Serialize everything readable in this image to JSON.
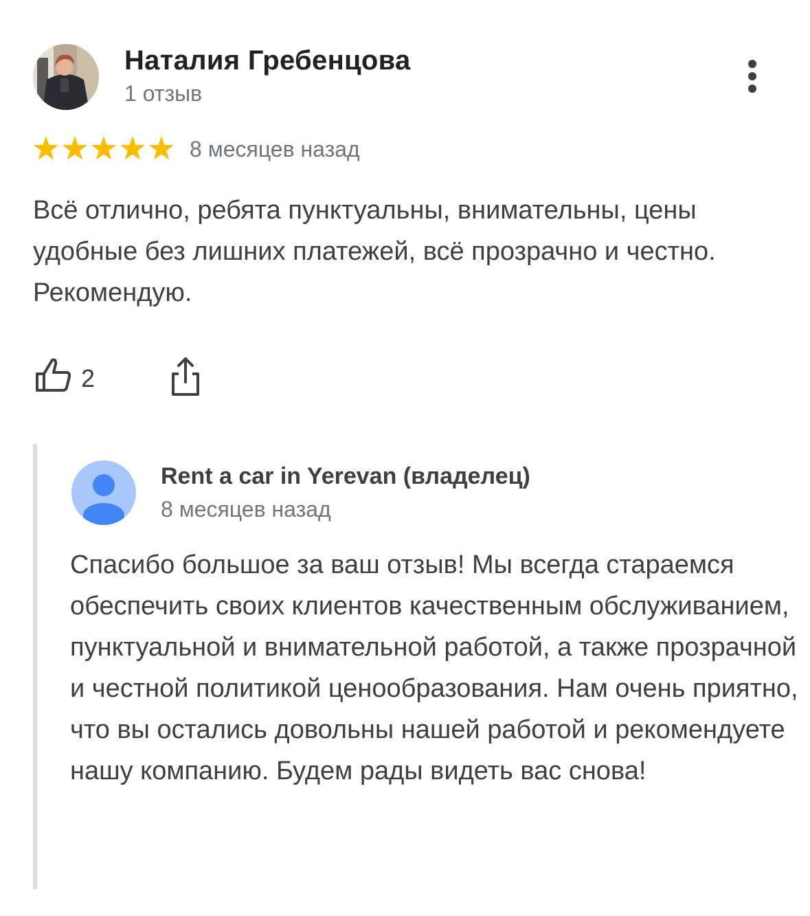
{
  "review": {
    "author_name": "Наталия Гребенцова",
    "author_meta": "1 отзыв",
    "rating": 5,
    "rating_max": 5,
    "date": "8 месяцев назад",
    "text": "Всё отлично, ребята пунктуальны, внимательны, цены удобные без лишних платежей, всё прозрачно и честно. Рекомендую.",
    "like_count": "2",
    "star_color": "#fbbc04"
  },
  "owner_reply": {
    "author_name": "Rent a car in Yerevan (владелец)",
    "date": "8 месяцев назад",
    "text": "Спасибо большое за ваш отзыв! Мы всегда стараемся обеспечить своих клиентов качественным обслуживанием, пунктуальной и внимательной работой, а также прозрачной и честной политикой ценообразования. Нам очень приятно, что вы остались довольны нашей работой и рекомендуете нашу компанию. Будем рады видеть вас снова!",
    "avatar_color": "#4285f4"
  }
}
